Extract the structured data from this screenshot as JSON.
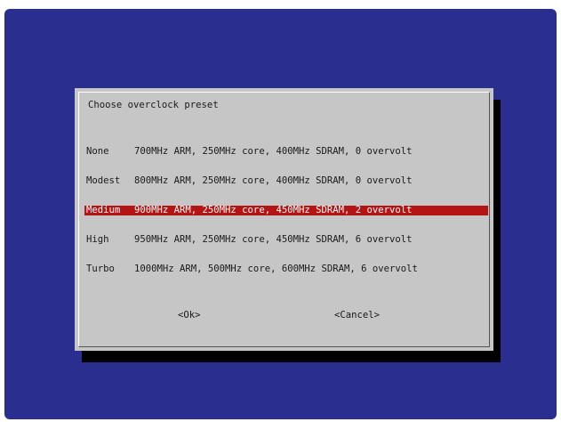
{
  "dialog": {
    "title": "Choose overclock preset",
    "items": [
      {
        "name": "None",
        "desc": "700MHz ARM, 250MHz core, 400MHz SDRAM, 0 overvolt",
        "selected": false
      },
      {
        "name": "Modest",
        "desc": "800MHz ARM, 250MHz core, 400MHz SDRAM, 0 overvolt",
        "selected": false
      },
      {
        "name": "Medium",
        "desc": "900MHz ARM, 250MHz core, 450MHz SDRAM, 2 overvolt",
        "selected": true
      },
      {
        "name": "High",
        "desc": "950MHz ARM, 250MHz core, 450MHz SDRAM, 6 overvolt",
        "selected": false
      },
      {
        "name": "Turbo",
        "desc": "1000MHz ARM, 500MHz core, 600MHz SDRAM, 6 overvolt",
        "selected": false
      }
    ],
    "ok_label": "<Ok>",
    "cancel_label": "<Cancel>"
  },
  "colors": {
    "background": "#2a2f8f",
    "dialog": "#c6c6c6",
    "selection": "#b41414"
  }
}
